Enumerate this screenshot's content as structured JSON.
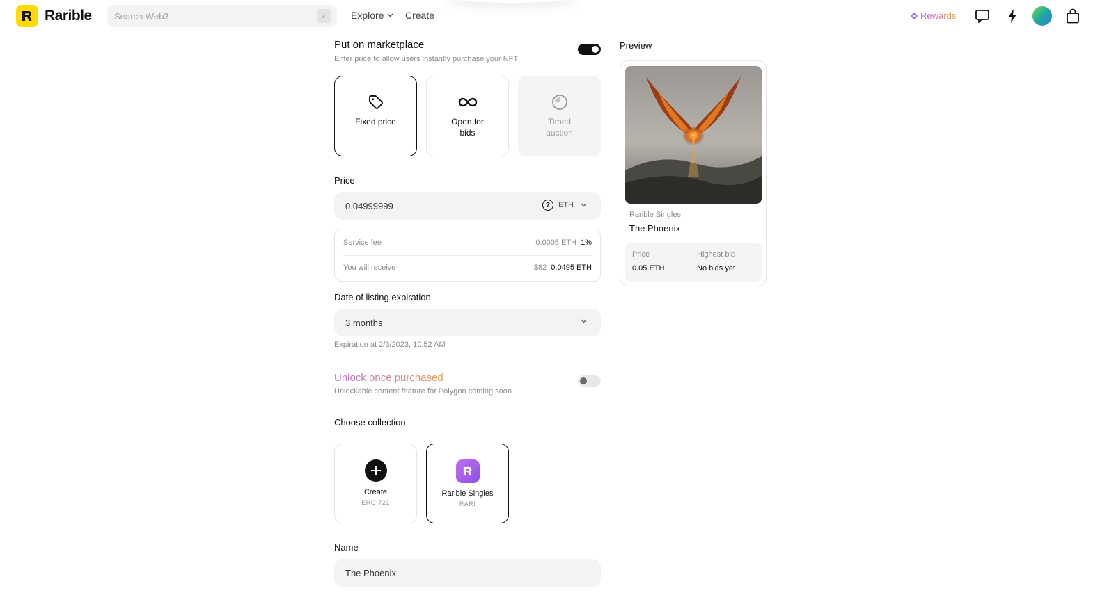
{
  "header": {
    "logo_text": "Rarible",
    "search_placeholder": "Search Web3",
    "search_shortcut": "/",
    "nav_explore": "Explore",
    "nav_create": "Create",
    "rewards_label": "Rewards"
  },
  "marketplace": {
    "title": "Put on marketplace",
    "subtitle": "Enter price to allow users instantly purchase your NFT",
    "enabled": true,
    "types": [
      {
        "label": "Fixed price",
        "icon": "tag-icon",
        "state": "selected"
      },
      {
        "label": "Open for bids",
        "icon": "infinity-icon",
        "state": "normal"
      },
      {
        "label": "Timed auction",
        "icon": "clock-icon",
        "state": "disabled"
      }
    ]
  },
  "price": {
    "label": "Price",
    "value": "0.04999999",
    "currency": "ETH"
  },
  "fees": {
    "service_fee_label": "Service fee",
    "service_fee_value": "0.0005 ETH",
    "service_fee_percent": "1%",
    "receive_label": "You will receive",
    "receive_usd": "$82",
    "receive_eth": "0.0495 ETH"
  },
  "expiration": {
    "label": "Date of listing expiration",
    "value": "3 months",
    "hint": "Expiration at 2/3/2023, 10:52 AM"
  },
  "unlock": {
    "title": "Unlock once purchased",
    "subtitle": "Unlockable content feature for Polygon coming soon",
    "enabled": false
  },
  "collection": {
    "label": "Choose collection",
    "options": [
      {
        "title": "Create",
        "sub": "ERC-721"
      },
      {
        "title": "Rarible Singles",
        "sub": "RARI"
      }
    ]
  },
  "name_field": {
    "label": "Name",
    "value": "The Phoenix"
  },
  "preview": {
    "title": "Preview",
    "collection": "Rarible Singles",
    "name": "The Phoenix",
    "price_label": "Price",
    "price_value": "0.05 ETH",
    "bid_label": "Highest bid",
    "bid_value": "No bids yet"
  },
  "colors": {
    "brand_yellow": "#FEDA03",
    "accent_purple": "#8a4fe8",
    "gradient_start": "#c06ad8",
    "gradient_end": "#e89a4a"
  }
}
